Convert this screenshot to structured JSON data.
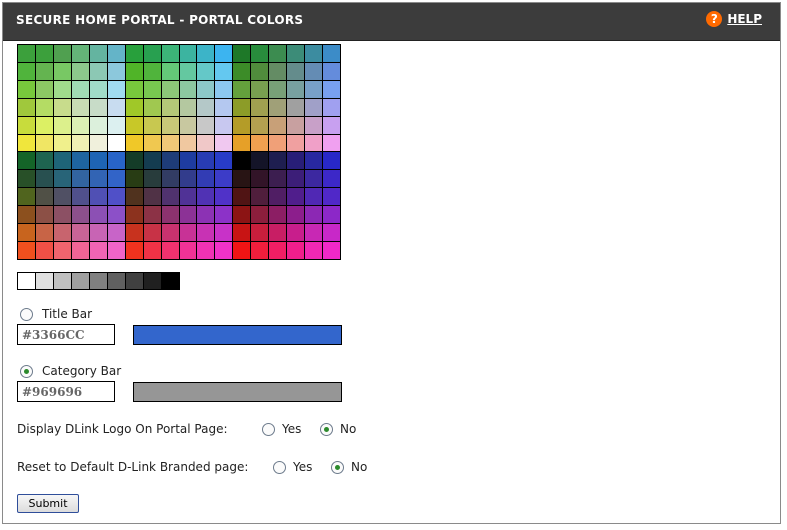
{
  "header": {
    "title": "SECURE HOME PORTAL - PORTAL COLORS",
    "help_label": "HELP",
    "help_icon_glyph": "?",
    "background": "#3c3c3c",
    "help_icon_color": "#ff6a00"
  },
  "palette": {
    "rows": [
      [
        "#3ca03c",
        "#3ca03c",
        "#50a050",
        "#64b478",
        "#64b4a0",
        "#64b4c8",
        "#28a03c",
        "#28a050",
        "#3cb478",
        "#3cb4a0",
        "#3cb4c8",
        "#3cb4f0",
        "#1e7828",
        "#288c3c",
        "#3c8c50",
        "#3c8c78",
        "#3c8ca0",
        "#3c8cc8"
      ],
      [
        "#50b43c",
        "#64b450",
        "#78c864",
        "#8cc88c",
        "#8cc8b4",
        "#8cc8dc",
        "#50b428",
        "#50b43c",
        "#64c878",
        "#64c8a0",
        "#64c8c8",
        "#64c8f0",
        "#3c8c28",
        "#508c3c",
        "#648c64",
        "#648c8c",
        "#648cb4",
        "#648cdc"
      ],
      [
        "#78c83c",
        "#8cc864",
        "#a0dc8c",
        "#a0dcb4",
        "#a0dcc8",
        "#a0dcf0",
        "#78c83c",
        "#78c850",
        "#8cc878",
        "#8cc8a0",
        "#8cc8c8",
        "#8cc8f0",
        "#64a03c",
        "#78a050",
        "#78a078",
        "#78a0a0",
        "#78a0c8",
        "#78a0f0"
      ],
      [
        "#a0c83c",
        "#b4dc64",
        "#c8dc8c",
        "#c8dcb4",
        "#c8dcc8",
        "#c8dcf0",
        "#a0c828",
        "#a0c850",
        "#b4c878",
        "#b4c8a0",
        "#b4c8c8",
        "#b4c8f0",
        "#8c9c28",
        "#a0a050",
        "#a0a078",
        "#a0a0a0",
        "#a0a0c8",
        "#a0a0f0"
      ],
      [
        "#c8dc3c",
        "#dcf064",
        "#dcf08c",
        "#dcf0b4",
        "#dcf0dc",
        "#dcf0f0",
        "#c8c828",
        "#c8c850",
        "#c8c878",
        "#c8c8a0",
        "#c8c8c8",
        "#c8c8f0",
        "#b49c28",
        "#b4a050",
        "#c8a078",
        "#c8a0a0",
        "#c8a0c8",
        "#c8a0f0"
      ],
      [
        "#f0e63c",
        "#f0e664",
        "#f0f08c",
        "#f0f0b4",
        "#f0f0dc",
        "#ffffff",
        "#f0c828",
        "#f0c850",
        "#f0c878",
        "#f0c8a0",
        "#f0c8c8",
        "#f0c8f0",
        "#e6a028",
        "#f0a050",
        "#f0a078",
        "#f0a0a0",
        "#f0a0c8",
        "#f0a0f0"
      ],
      [
        "#146428",
        "#1e6450",
        "#1e6478",
        "#1e64a0",
        "#1e64b4",
        "#2864c8",
        "#143c28",
        "#143c50",
        "#1e3c78",
        "#1e3ca0",
        "#283cb4",
        "#283cc8",
        "#000000",
        "#141428",
        "#1e1e50",
        "#281e78",
        "#2828a0",
        "#2828c8"
      ],
      [
        "#285028",
        "#285050",
        "#286478",
        "#3264a0",
        "#3264b4",
        "#3264c8",
        "#283c14",
        "#283c3c",
        "#323c64",
        "#323c8c",
        "#323cb4",
        "#3c3cc8",
        "#281414",
        "#321428",
        "#3c1e50",
        "#3c1e78",
        "#3c28a0",
        "#3c28c8"
      ],
      [
        "#50641e",
        "#505046",
        "#505064",
        "#50508c",
        "#5050b4",
        "#5050c8",
        "#50321e",
        "#503246",
        "#50326e",
        "#503296",
        "#5032b4",
        "#5032c8",
        "#501414",
        "#501e3c",
        "#501e64",
        "#501e8c",
        "#5028b4",
        "#5028c8"
      ],
      [
        "#8c501e",
        "#8c5046",
        "#8c5064",
        "#8c508c",
        "#8c50b4",
        "#8c50c8",
        "#8c321e",
        "#8c3246",
        "#8c326e",
        "#8c3296",
        "#8c32b4",
        "#8c32c8",
        "#8c1414",
        "#8c1e3c",
        "#8c1e64",
        "#8c1e8c",
        "#8c28b4",
        "#8c28c8"
      ],
      [
        "#c8641e",
        "#c86446",
        "#c8646e",
        "#c86496",
        "#c864b4",
        "#c864c8",
        "#c8321e",
        "#c83246",
        "#c8326e",
        "#c83296",
        "#c832b4",
        "#c832c8",
        "#c81414",
        "#c81e3c",
        "#c81e64",
        "#c81e8c",
        "#c828b4",
        "#c828c8"
      ],
      [
        "#f0501e",
        "#f05046",
        "#f0646e",
        "#f06496",
        "#f064b4",
        "#f064c8",
        "#f0321e",
        "#f03246",
        "#f0326e",
        "#f03296",
        "#f032b4",
        "#f032c8",
        "#f01414",
        "#f01e3c",
        "#f01e64",
        "#f01e8c",
        "#f028b4",
        "#f028c8"
      ]
    ]
  },
  "grayscale": [
    "#ffffff",
    "#e0e0e0",
    "#c0c0c0",
    "#a0a0a0",
    "#808080",
    "#606060",
    "#404040",
    "#202020",
    "#000000"
  ],
  "title_bar": {
    "label": "Title Bar",
    "selected": false,
    "hex_value": "#3366CC",
    "swatch_color": "#3366cc"
  },
  "category_bar": {
    "label": "Category Bar",
    "selected": true,
    "hex_value": "#969696",
    "swatch_color": "#969696"
  },
  "display_logo": {
    "label": "Display DLink Logo On Portal Page:",
    "yes_label": "Yes",
    "no_label": "No",
    "selected": "No"
  },
  "reset_default": {
    "label": "Reset to Default D-Link Branded page:",
    "yes_label": "Yes",
    "no_label": "No",
    "selected": "No"
  },
  "submit_label": "Submit"
}
